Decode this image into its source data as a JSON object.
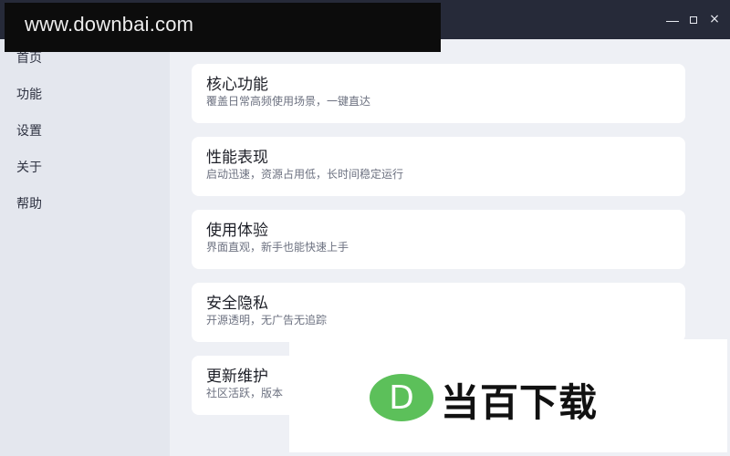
{
  "window": {
    "min_label": "",
    "max_label": "",
    "close_label": "×"
  },
  "sidebar": {
    "items": [
      {
        "label": "首页"
      },
      {
        "label": "功能"
      },
      {
        "label": "设置"
      },
      {
        "label": "关于"
      },
      {
        "label": "帮助"
      }
    ]
  },
  "cards": [
    {
      "title": "核心功能",
      "desc": "覆盖日常高频使用场景，一键直达"
    },
    {
      "title": "性能表现",
      "desc": "启动迅速，资源占用低，长时间稳定运行"
    },
    {
      "title": "使用体验",
      "desc": "界面直观，新手也能快速上手"
    },
    {
      "title": "安全隐私",
      "desc": "开源透明，无广告无追踪"
    },
    {
      "title": "更新维护",
      "desc": "社区活跃，版本"
    }
  ],
  "watermarks": {
    "top_text": "www.downbai.com",
    "bottom_text": "当百下载",
    "logo_letter": "D",
    "logo_color": "#5cc05a"
  },
  "colors": {
    "titlebar": "#262a39",
    "sidebar": "#e4e7ee",
    "content_bg": "#eef0f5",
    "card_bg": "#ffffff"
  }
}
